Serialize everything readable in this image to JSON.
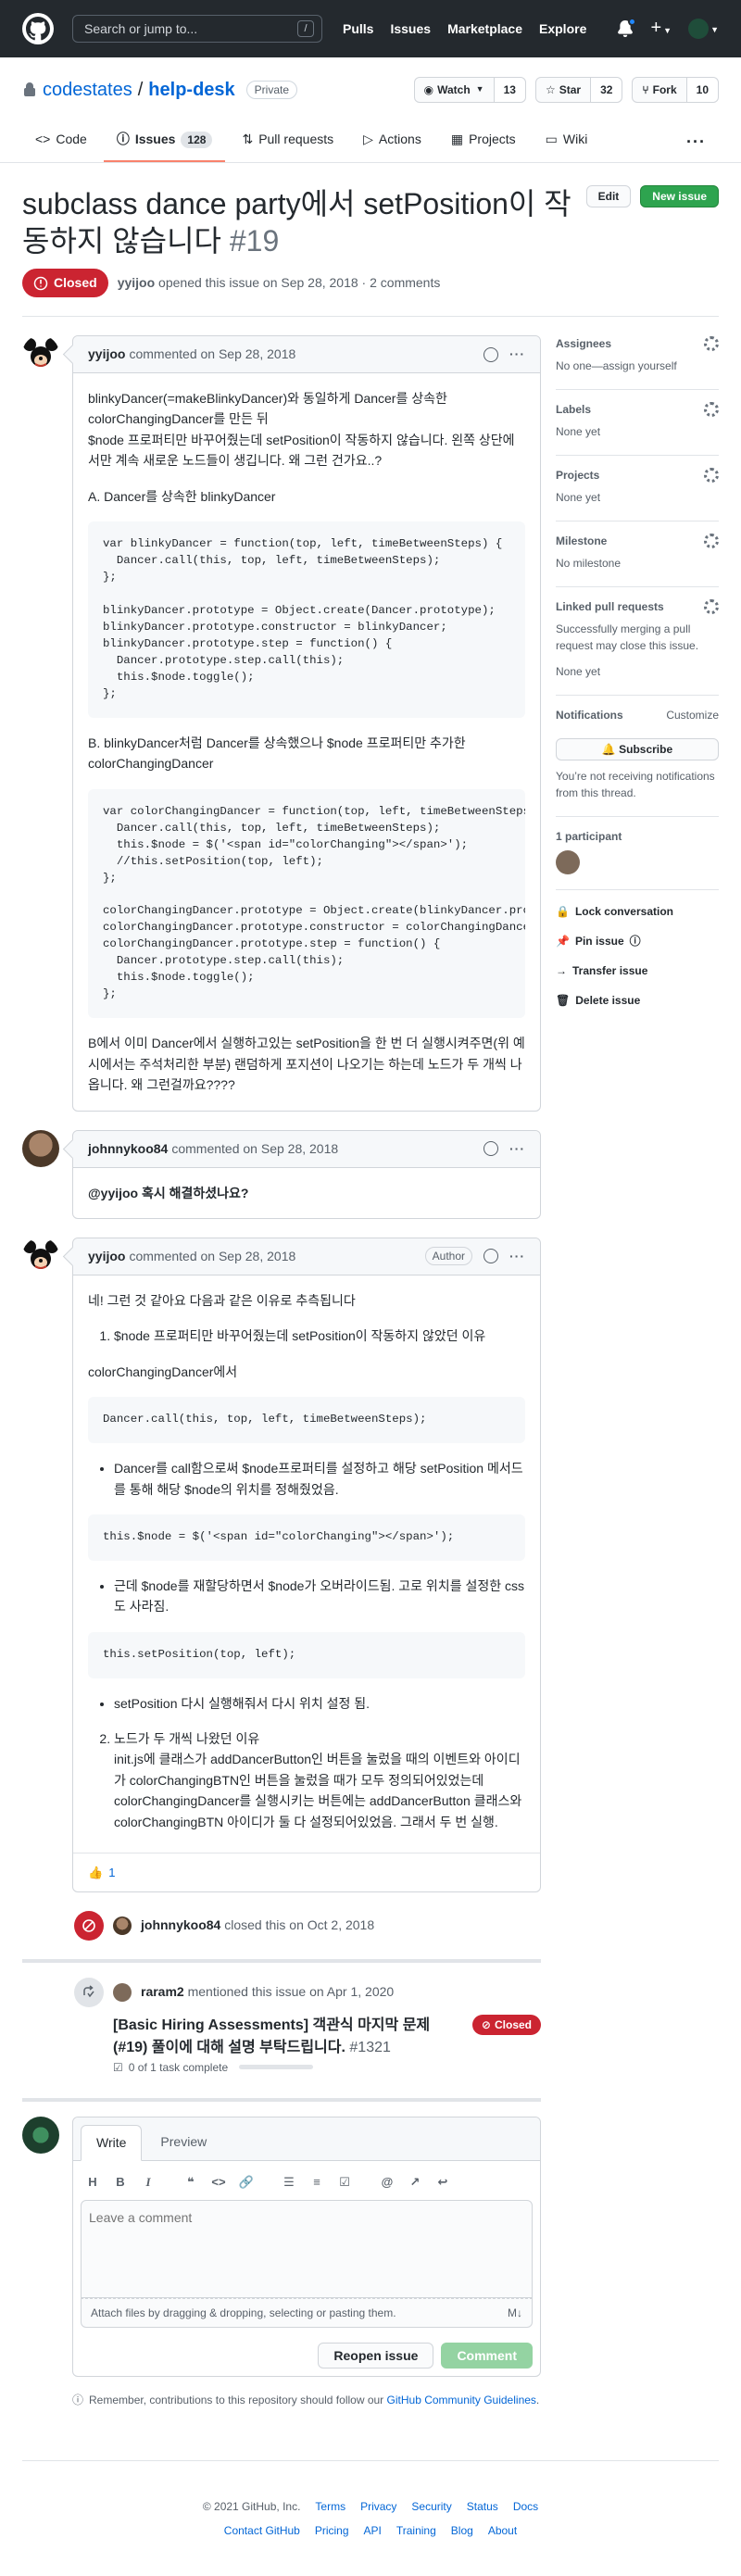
{
  "global_header": {
    "search_placeholder": "Search or jump to...",
    "search_shortcut": "/",
    "nav": [
      "Pulls",
      "Issues",
      "Marketplace",
      "Explore"
    ]
  },
  "repo": {
    "owner": "codestates",
    "separator": "/",
    "name": "help-desk",
    "visibility": "Private",
    "watch_label": "Watch",
    "watch_count": "13",
    "star_label": "Star",
    "star_count": "32",
    "fork_label": "Fork",
    "fork_count": "10",
    "tabs": [
      {
        "label": "Code",
        "icon": "code-icon"
      },
      {
        "label": "Issues",
        "icon": "issue-opened-icon",
        "count": "128"
      },
      {
        "label": "Pull requests",
        "icon": "git-pull-request-icon"
      },
      {
        "label": "Actions",
        "icon": "play-icon"
      },
      {
        "label": "Projects",
        "icon": "project-icon"
      },
      {
        "label": "Wiki",
        "icon": "book-icon"
      }
    ],
    "more_label": "···"
  },
  "issue": {
    "title": "subclass dance party에서 setPosition이 작동하지 않습니다",
    "number": "#19",
    "edit_label": "Edit",
    "new_issue_label": "New issue",
    "state": "Closed",
    "author": "yyijoo",
    "opened_text": "opened this issue on Sep 28, 2018 · 2 comments"
  },
  "comments": {
    "c1": {
      "author": "yyijoo",
      "date": "commented on Sep 28, 2018",
      "p1": "blinkyDancer(=makeBlinkyDancer)와 동일하게 Dancer를 상속한 colorChangingDancer를 만든 뒤\n$node 프로퍼티만 바꾸어줬는데 setPosition이 작동하지 않습니다. 왼쪽 상단에서만 계속 새로운 노드들이 생깁니다. 왜 그런 건가요..?",
      "p2": "A. Dancer를 상속한 blinkyDancer",
      "code1": "var blinkyDancer = function(top, left, timeBetweenSteps) {\n  Dancer.call(this, top, left, timeBetweenSteps);\n};\n\nblinkyDancer.prototype = Object.create(Dancer.prototype);\nblinkyDancer.prototype.constructor = blinkyDancer;\nblinkyDancer.prototype.step = function() {\n  Dancer.prototype.step.call(this);\n  this.$node.toggle();\n};",
      "p3": "B. blinkyDancer처럼 Dancer를 상속했으나 $node 프로퍼티만 추가한 colorChangingDancer",
      "code2": "var colorChangingDancer = function(top, left, timeBetweenSteps) {\n  Dancer.call(this, top, left, timeBetweenSteps);\n  this.$node = $('<span id=\"colorChanging\"></span>');\n  //this.setPosition(top, left);\n};\n\ncolorChangingDancer.prototype = Object.create(blinkyDancer.prototype);\ncolorChangingDancer.prototype.constructor = colorChangingDancer;\ncolorChangingDancer.prototype.step = function() {\n  Dancer.prototype.step.call(this);\n  this.$node.toggle();\n};",
      "p4": "B에서 이미 Dancer에서 실행하고있는 setPosition을 한 번 더 실행시켜주면(위 예시에서는 주석처리한 부분) 랜덤하게 포지션이 나오기는 하는데 노드가 두 개씩 나옵니다. 왜 그런걸까요????"
    },
    "c2": {
      "author": "johnnykoo84",
      "date": "commented on Sep 28, 2018",
      "body": "@yyijoo 혹시 해결하셨나요?"
    },
    "c3": {
      "author": "yyijoo",
      "date": "commented on Sep 28, 2018",
      "badge": "Author",
      "p1": "네! 그런 것 같아요 다음과 같은 이유로 추측됩니다",
      "li1": "$node 프로퍼티만 바꾸어줬는데 setPosition이 작동하지 않았던 이유",
      "p2": "colorChangingDancer에서",
      "code1": "Dancer.call(this, top, left, timeBetweenSteps);",
      "b1": "Dancer를 call함으로써 $node프로퍼티를 설정하고 해당 setPosition 메서드를 통해 해당 $node의 위치를 정해줬었음.",
      "code2": "this.$node = $('<span id=\"colorChanging\"></span>');",
      "b2": "근데 $node를 재할당하면서 $node가 오버라이드됨. 고로 위치를 설정한 css도 사라짐.",
      "code3": "this.setPosition(top, left);",
      "b3": "setPosition 다시 실행해줘서 다시 위치 설정 됨.",
      "li2_title": "노드가 두 개씩 나왔던 이유",
      "li2_body": "init.js에 클래스가 addDancerButton인 버튼을 눌렀을 때의 이벤트와 아이디가 colorChangingBTN인 버튼을 눌렀을 때가 모두 정의되어있었는데 colorChangingDancer를 실행시키는 버튼에는 addDancerButton 클래스와 colorChangingBTN 아이디가 둘 다 설정되어있었음. 그래서 두 번 실행.",
      "reaction_emoji": "👍",
      "reaction_count": "1"
    }
  },
  "events": {
    "closed": {
      "actor": "johnnykoo84",
      "text": "closed this on Oct 2, 2018"
    },
    "mention": {
      "actor": "raram2",
      "text": "mentioned this issue on Apr 1, 2020",
      "ref_title": "[Basic Hiring Assessments] 객관식 마지막 문제 (#19) 풀이에 대해 설명 부탁드립니다.",
      "ref_number": "#1321",
      "ref_state": "Closed",
      "tasks": "0 of 1 task complete"
    }
  },
  "composer": {
    "tab_write": "Write",
    "tab_preview": "Preview",
    "placeholder": "Leave a comment",
    "attach_text": "Attach files by dragging & dropping, selecting or pasting them.",
    "reopen_label": "Reopen issue",
    "comment_label": "Comment",
    "tip_prefix": "Remember, contributions to this repository should follow our ",
    "tip_link": "GitHub Community Guidelines",
    "tip_suffix": "."
  },
  "sidebar": {
    "assignees": {
      "title": "Assignees",
      "value": "No one—assign yourself"
    },
    "labels": {
      "title": "Labels",
      "value": "None yet"
    },
    "projects": {
      "title": "Projects",
      "value": "None yet"
    },
    "milestone": {
      "title": "Milestone",
      "value": "No milestone"
    },
    "linked": {
      "title": "Linked pull requests",
      "desc": "Successfully merging a pull request may close this issue.",
      "value": "None yet"
    },
    "notifications": {
      "title": "Notifications",
      "customize": "Customize",
      "button": "Subscribe",
      "desc": "You’re not receiving notifications from this thread."
    },
    "participants": {
      "title": "1 participant"
    },
    "actions": [
      "Lock conversation",
      "Pin issue",
      "Transfer issue",
      "Delete issue"
    ]
  },
  "footer": {
    "copyright": "© 2021 GitHub, Inc.",
    "row1": [
      "Terms",
      "Privacy",
      "Security",
      "Status",
      "Docs"
    ],
    "row2": [
      "Contact GitHub",
      "Pricing",
      "API",
      "Training",
      "Blog",
      "About"
    ]
  },
  "colors": {
    "closed": "#cb2431",
    "primary": "#2ea44f",
    "link": "#0366d6",
    "header_bg": "#24292e"
  }
}
